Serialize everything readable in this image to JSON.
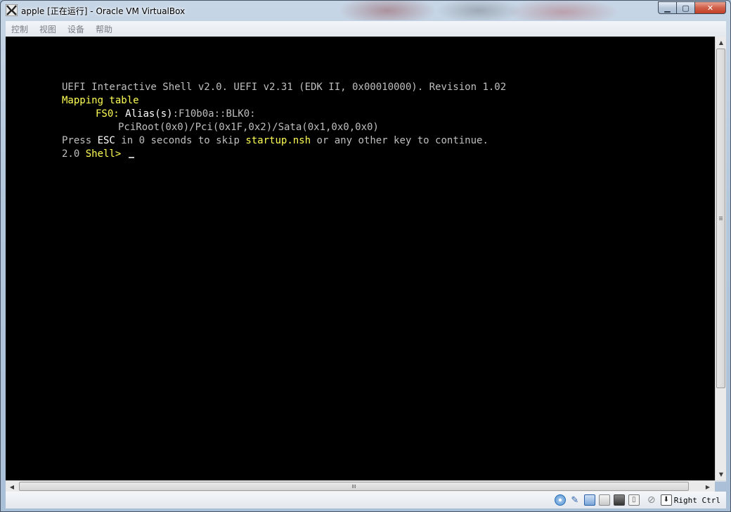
{
  "window": {
    "title": "apple [正在运行] - Oracle VM VirtualBox",
    "minimize_glyph": "▁",
    "maximize_glyph": "▢",
    "close_glyph": "✕"
  },
  "menu": {
    "items": [
      "控制",
      "视图",
      "设备",
      "帮助"
    ]
  },
  "console": {
    "line1": "UEFI Interactive Shell v2.0. UEFI v2.31 (EDK II, 0x00010000). Revision 1.02",
    "line2": "Mapping table",
    "line3": {
      "fs": "FS0",
      "sep": ":",
      "alias_label": " Alias(s)",
      "alias_value": ":F10b0a::BLK0:"
    },
    "line4": "PciRoot(0x0)/Pci(0x1F,0x2)/Sata(0x1,0x0,0x0)",
    "line5": {
      "press": "Press ",
      "esc": "ESC",
      "middle": " in 0 seconds to skip ",
      "script": "startup.nsh",
      "end": " or any other key to continue."
    },
    "line6": {
      "version": "2.0 ",
      "prompt": "Shell>",
      "tail": " "
    }
  },
  "scrollbars": {
    "up": "▲",
    "down": "▼",
    "left": "◀",
    "right": "▶"
  },
  "status": {
    "host_key": "Right Ctrl"
  },
  "colors": {
    "console_bg": "#000000",
    "console_text": "#bfbfbf",
    "highlight_yellow": "#ffff55",
    "highlight_white": "#ffffff"
  }
}
